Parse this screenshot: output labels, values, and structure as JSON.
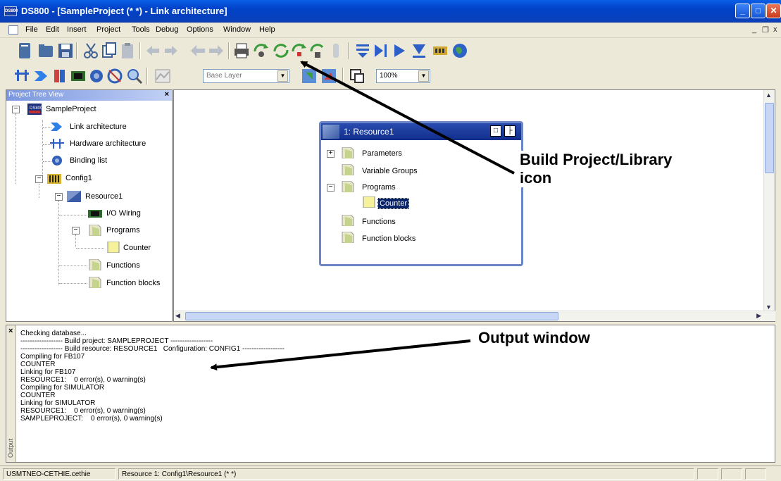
{
  "window": {
    "app_icon": "DS800",
    "title": "DS800 - [SampleProject (*  *) - Link architecture]"
  },
  "menu": [
    "File",
    "Edit",
    "Insert",
    "Project",
    "Tools",
    "Debug",
    "Options",
    "Window",
    "Help"
  ],
  "toolbar": {
    "layer_combo": "Base Layer",
    "zoom_combo": "100%"
  },
  "project_tree": {
    "title": "Project Tree View",
    "items": {
      "root": "SampleProject",
      "link_architecture": "Link architecture",
      "hardware_architecture": "Hardware architecture",
      "binding_list": "Binding list",
      "config": "Config1",
      "resource": "Resource1",
      "io_wiring": "I/O Wiring",
      "programs": "Programs",
      "counter": "Counter",
      "functions": "Functions",
      "function_blocks": "Function blocks"
    }
  },
  "resource_window": {
    "title": "1: Resource1",
    "items": {
      "parameters": "Parameters",
      "variable_groups": "Variable Groups",
      "programs": "Programs",
      "counter": "Counter",
      "functions": "Functions",
      "function_blocks": "Function blocks"
    }
  },
  "callouts": {
    "build_line1": "Build Project/Library",
    "build_line2": "icon",
    "output": "Output window"
  },
  "output": {
    "label": "Output",
    "lines": [
      "Checking database...",
      "------------------ Build project: SAMPLEPROJECT ------------------",
      "------------------ Build resource: RESOURCE1   Configuration: CONFIG1 ------------------",
      "Compiling for FB107",
      "COUNTER",
      "Linking for FB107",
      "RESOURCE1:    0 error(s), 0 warning(s)",
      "Compiling for SIMULATOR",
      "COUNTER",
      "Linking for SIMULATOR",
      "RESOURCE1:    0 error(s), 0 warning(s)",
      "SAMPLEPROJECT:    0 error(s), 0 warning(s)"
    ]
  },
  "status": {
    "user": "USMTNEO-CETHIE.cethie",
    "location": "Resource 1: Config1\\Resource1 (*  *)"
  }
}
